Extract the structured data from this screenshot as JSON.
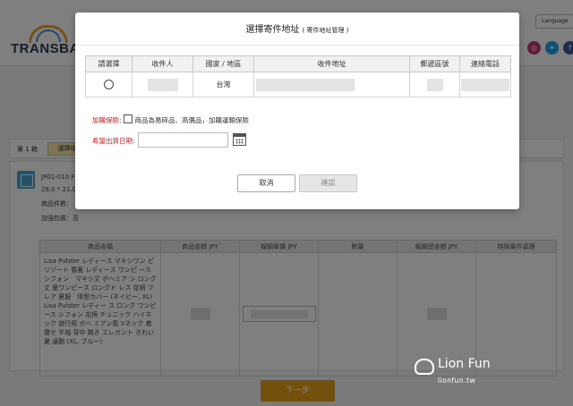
{
  "header": {
    "logo_text": "TRANSBA",
    "language_label": "Language",
    "social_icons": [
      "instagram-icon",
      "twitter-icon",
      "facebook-icon"
    ]
  },
  "step_bar": {
    "label": "第 1 箱",
    "button_label": "選擇收"
  },
  "package": {
    "code": "JP01-010 F",
    "size": "28.0 * 21.0",
    "items_count": "商品件數：",
    "packaging": "加強包裝：否"
  },
  "items_table": {
    "headers": [
      "商品名稱",
      "商品金額 JPY",
      "報關單價 JPY",
      "數量",
      "報關總金額 JPY",
      "特殊案件處理"
    ],
    "product_name": "Lisa Pulster レディース マキシワン ピ リゾート 春夏 レディース ワンピ ース シフォン　マキシ丈 ボヘミア ン ロング丈 夏ワンピース ロングド レス 花柄 フレア 夏服　体型カバー (ネイビー, XL) Lisa Pulster レディー ス ロング ワンピース シフォン 花柄 チュニック ハイネック 旅行用 ボヘ ミアン風 Vネック 着痩せ 半袖 背中 開き エレガント きれい 夏 通勤 (XL, ブルー)"
  },
  "next_button": "下一步",
  "watermark": {
    "brand": "Lion Fun",
    "url": "lionfun.tw"
  },
  "modal": {
    "title": "選擇寄件地址",
    "subtitle": "( 寄件地址管理 )",
    "table_headers": [
      "請選擇",
      "收件人",
      "國家 / 地區",
      "收件地址",
      "郵遞區號",
      "連絡電話"
    ],
    "row": {
      "country": "台灣"
    },
    "insurance_label": "加購保險:",
    "insurance_text": "商品為易碎品、高價品，加購運輸保險",
    "date_label": "希望出貨日期:",
    "cancel_label": "取消",
    "confirm_label": "確認"
  }
}
